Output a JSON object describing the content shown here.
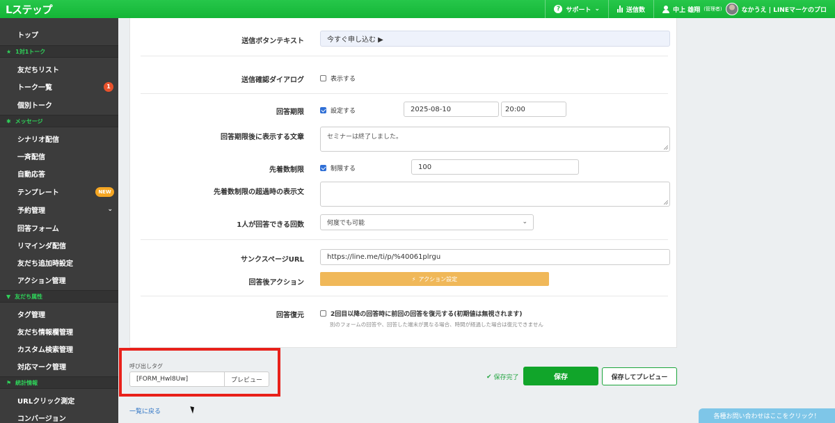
{
  "header": {
    "logo": "Lステップ",
    "support": "サポート",
    "sends": "送信数",
    "user": "中上 雄翔",
    "user_role": "(管理者)",
    "account": "なかうえ | LINEマーケのプロ"
  },
  "sidebar": {
    "items": [
      {
        "label": "トップ"
      },
      {
        "section": "1対1トーク"
      },
      {
        "label": "友だちリスト"
      },
      {
        "label": "トーク一覧",
        "badge": "1"
      },
      {
        "label": "個別トーク"
      },
      {
        "section": "メッセージ"
      },
      {
        "label": "シナリオ配信"
      },
      {
        "label": "一斉配信"
      },
      {
        "label": "自動応答"
      },
      {
        "label": "テンプレート",
        "new": "NEW"
      },
      {
        "label": "予約管理"
      },
      {
        "label": "回答フォーム"
      },
      {
        "label": "リマインダ配信"
      },
      {
        "label": "友だち追加時設定"
      },
      {
        "label": "アクション管理"
      },
      {
        "section": "友だち属性"
      },
      {
        "label": "タグ管理"
      },
      {
        "label": "友だち情報欄管理"
      },
      {
        "label": "カスタム検索管理"
      },
      {
        "label": "対応マーク管理"
      },
      {
        "section": "統計情報"
      },
      {
        "label": "URLクリック測定"
      },
      {
        "label": "コンバージョン"
      }
    ]
  },
  "form": {
    "submit_text_label": "送信ボタンテキスト",
    "submit_text_value": "今すぐ申し込む ▶",
    "confirm_dialog_label": "送信確認ダイアログ",
    "confirm_dialog_option": "表示する",
    "deadline_label": "回答期限",
    "deadline_option": "設定する",
    "deadline_date": "2025-08-10",
    "deadline_time": "20:00",
    "after_deadline_label": "回答期限後に表示する文章",
    "after_deadline_text": "セミナーは終了しました。",
    "limit_label": "先着数制限",
    "limit_option": "制限する",
    "limit_value": "100",
    "over_limit_label": "先着数制限の超過時の表示文",
    "over_limit_text": "",
    "per_person_label": "1人が回答できる回数",
    "per_person_value": "何度でも可能",
    "thanks_url_label": "サンクスページURL",
    "thanks_url_value": "https://line.me/ti/p/%40061plrgu",
    "after_action_label": "回答後アクション",
    "after_action_button": "アクション設定",
    "restore_label": "回答復元",
    "restore_option": "2回目以降の回答時に前回の回答を復元する(初期値は無視されます)",
    "restore_note": "別のフォームの回答や、回答した端末が異なる場合、時間が経過した場合は復元できません"
  },
  "bottom": {
    "tag_label": "呼び出しタグ",
    "tag_value": "[FORM_Hwl8Uw]",
    "tag_preview": "プレビュー",
    "saved_text": "保存完了",
    "save_button": "保存",
    "save_preview_button": "保存してプレビュー",
    "back_link": "一覧に戻る",
    "contact": "各種お問い合わせはここをクリック！"
  },
  "colors": {
    "brand_green": "#14b536",
    "sidebar_bg": "#3c3c3c",
    "highlight_red": "#e8201a",
    "action_orange": "#f0b859"
  }
}
